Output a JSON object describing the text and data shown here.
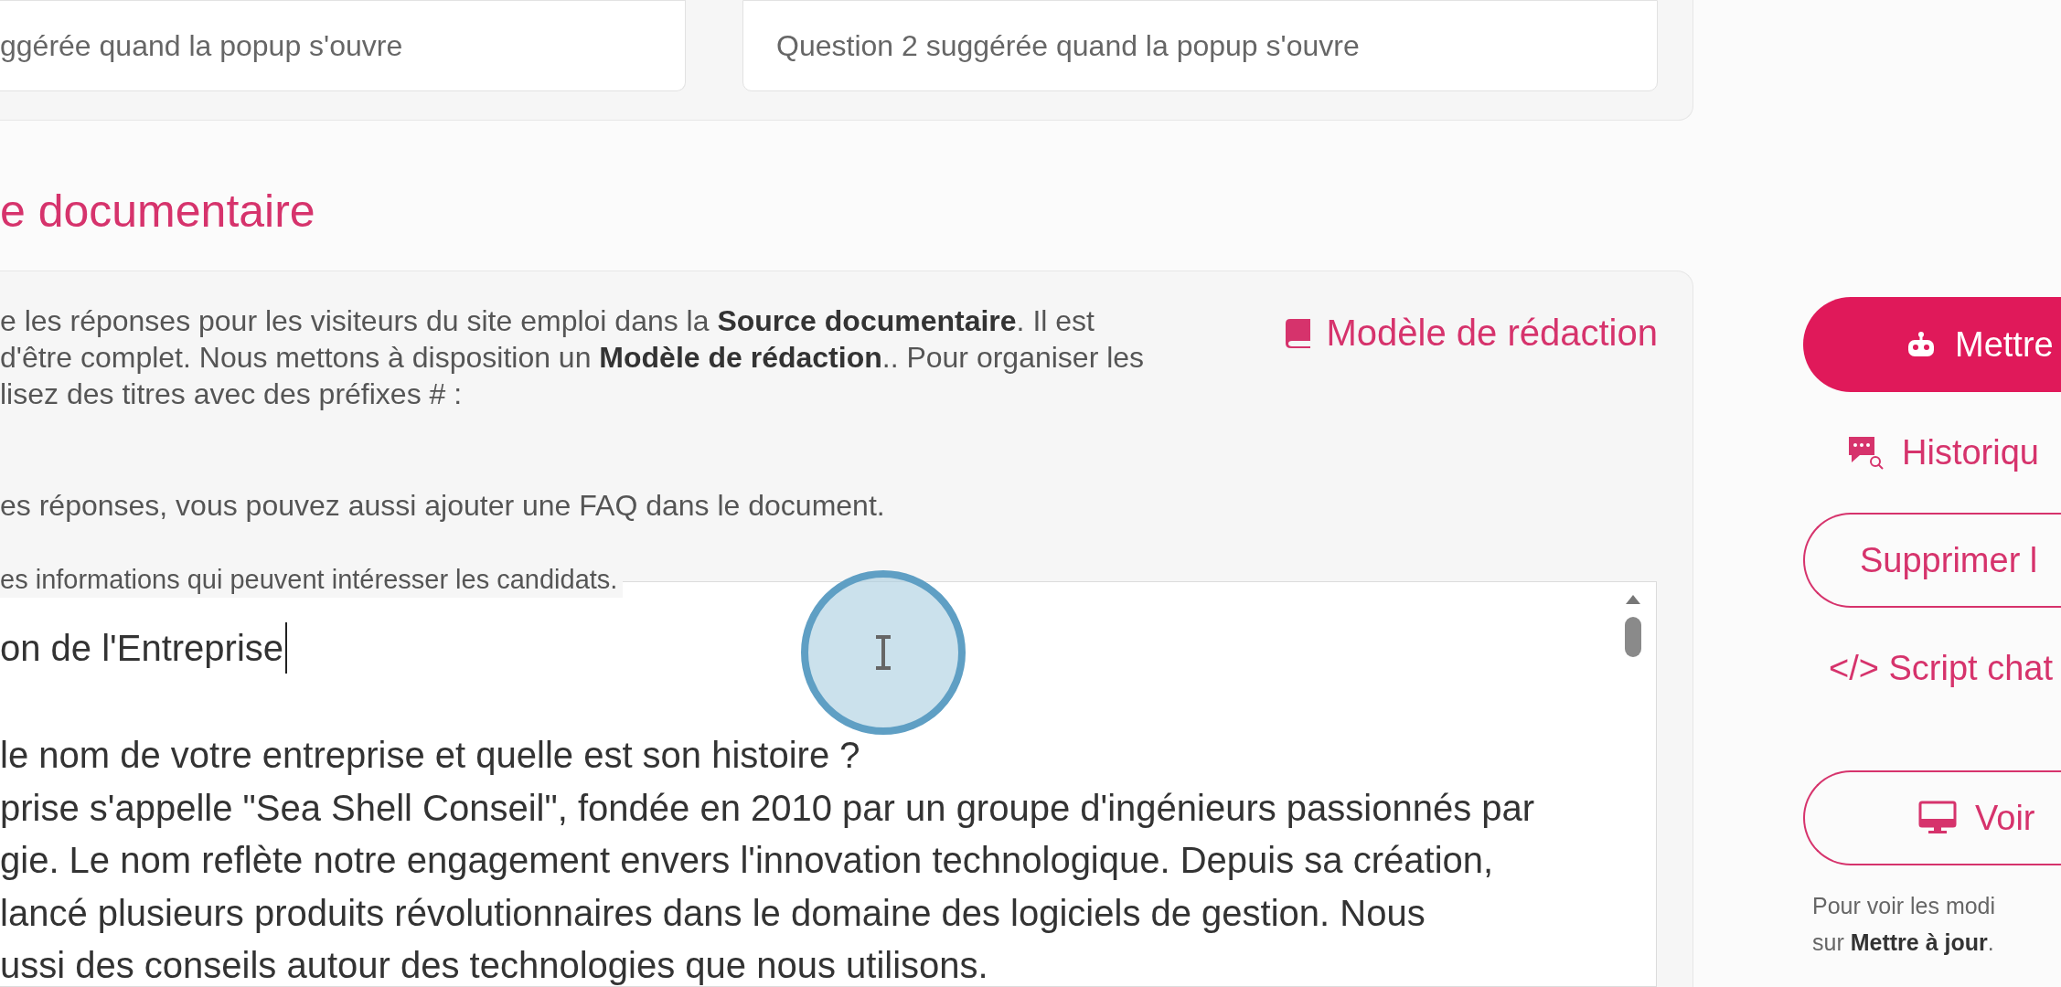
{
  "suggestions": [
    {
      "placeholder": "ggérée quand la popup s'ouvre"
    },
    {
      "placeholder": "Question 2 suggérée quand la popup s'ouvre"
    }
  ],
  "section_title": "e documentaire",
  "description": {
    "lines": [
      "e les réponses pour les visiteurs du site emploi dans la **Source documentaire**. Il est",
      "d'être complet. Nous mettons à disposition un **Modèle de rédaction**.. Pour organiser les",
      "lisez des titres avec des préfixes # :"
    ],
    "faq_note": "es réponses, vous pouvez aussi ajouter une FAQ dans le document.",
    "field_label": "es informations qui peuvent intéresser les candidats."
  },
  "template_link": "Modèle de rédaction",
  "editor": {
    "heading": "on de l'Entreprise",
    "lines": [
      "le nom de votre entreprise et quelle est son histoire ?",
      "prise s'appelle \"Sea Shell Conseil\", fondée en 2010 par un groupe d'ingénieurs passionnés par",
      "gie. Le nom reflète notre engagement envers l'innovation technologique. Depuis sa création,",
      "lancé plusieurs produits révolutionnaires dans le domaine des logiciels de gestion. Nous",
      "ussi des conseils autour des technologies que nous utilisons."
    ]
  },
  "actions": [
    {
      "kind": "primary",
      "label": "Mettre"
    },
    {
      "kind": "link",
      "label": "Historiqu"
    },
    {
      "kind": "outline",
      "label": "Supprimer l"
    },
    {
      "kind": "link",
      "label": "</> Script chat"
    },
    {
      "kind": "outline",
      "label": "Voir"
    }
  ],
  "update_note": [
    "Pour voir les modi",
    "sur **Mettre à jour**."
  ]
}
